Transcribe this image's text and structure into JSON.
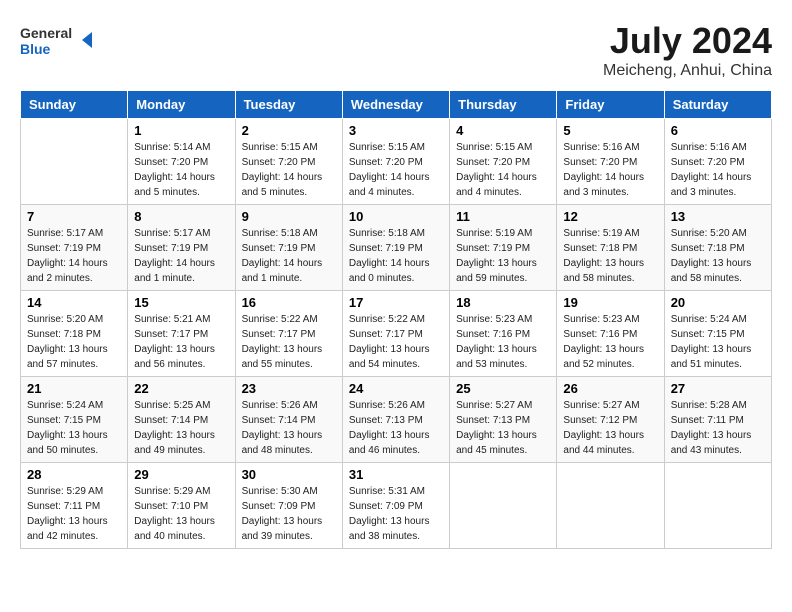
{
  "header": {
    "logo_text_general": "General",
    "logo_text_blue": "Blue",
    "month_year": "July 2024",
    "location": "Meicheng, Anhui, China"
  },
  "weekdays": [
    "Sunday",
    "Monday",
    "Tuesday",
    "Wednesday",
    "Thursday",
    "Friday",
    "Saturday"
  ],
  "weeks": [
    [
      {
        "day": "",
        "sunrise": "",
        "sunset": "",
        "daylight": ""
      },
      {
        "day": "1",
        "sunrise": "Sunrise: 5:14 AM",
        "sunset": "Sunset: 7:20 PM",
        "daylight": "Daylight: 14 hours and 5 minutes."
      },
      {
        "day": "2",
        "sunrise": "Sunrise: 5:15 AM",
        "sunset": "Sunset: 7:20 PM",
        "daylight": "Daylight: 14 hours and 5 minutes."
      },
      {
        "day": "3",
        "sunrise": "Sunrise: 5:15 AM",
        "sunset": "Sunset: 7:20 PM",
        "daylight": "Daylight: 14 hours and 4 minutes."
      },
      {
        "day": "4",
        "sunrise": "Sunrise: 5:15 AM",
        "sunset": "Sunset: 7:20 PM",
        "daylight": "Daylight: 14 hours and 4 minutes."
      },
      {
        "day": "5",
        "sunrise": "Sunrise: 5:16 AM",
        "sunset": "Sunset: 7:20 PM",
        "daylight": "Daylight: 14 hours and 3 minutes."
      },
      {
        "day": "6",
        "sunrise": "Sunrise: 5:16 AM",
        "sunset": "Sunset: 7:20 PM",
        "daylight": "Daylight: 14 hours and 3 minutes."
      }
    ],
    [
      {
        "day": "7",
        "sunrise": "Sunrise: 5:17 AM",
        "sunset": "Sunset: 7:19 PM",
        "daylight": "Daylight: 14 hours and 2 minutes."
      },
      {
        "day": "8",
        "sunrise": "Sunrise: 5:17 AM",
        "sunset": "Sunset: 7:19 PM",
        "daylight": "Daylight: 14 hours and 1 minute."
      },
      {
        "day": "9",
        "sunrise": "Sunrise: 5:18 AM",
        "sunset": "Sunset: 7:19 PM",
        "daylight": "Daylight: 14 hours and 1 minute."
      },
      {
        "day": "10",
        "sunrise": "Sunrise: 5:18 AM",
        "sunset": "Sunset: 7:19 PM",
        "daylight": "Daylight: 14 hours and 0 minutes."
      },
      {
        "day": "11",
        "sunrise": "Sunrise: 5:19 AM",
        "sunset": "Sunset: 7:19 PM",
        "daylight": "Daylight: 13 hours and 59 minutes."
      },
      {
        "day": "12",
        "sunrise": "Sunrise: 5:19 AM",
        "sunset": "Sunset: 7:18 PM",
        "daylight": "Daylight: 13 hours and 58 minutes."
      },
      {
        "day": "13",
        "sunrise": "Sunrise: 5:20 AM",
        "sunset": "Sunset: 7:18 PM",
        "daylight": "Daylight: 13 hours and 58 minutes."
      }
    ],
    [
      {
        "day": "14",
        "sunrise": "Sunrise: 5:20 AM",
        "sunset": "Sunset: 7:18 PM",
        "daylight": "Daylight: 13 hours and 57 minutes."
      },
      {
        "day": "15",
        "sunrise": "Sunrise: 5:21 AM",
        "sunset": "Sunset: 7:17 PM",
        "daylight": "Daylight: 13 hours and 56 minutes."
      },
      {
        "day": "16",
        "sunrise": "Sunrise: 5:22 AM",
        "sunset": "Sunset: 7:17 PM",
        "daylight": "Daylight: 13 hours and 55 minutes."
      },
      {
        "day": "17",
        "sunrise": "Sunrise: 5:22 AM",
        "sunset": "Sunset: 7:17 PM",
        "daylight": "Daylight: 13 hours and 54 minutes."
      },
      {
        "day": "18",
        "sunrise": "Sunrise: 5:23 AM",
        "sunset": "Sunset: 7:16 PM",
        "daylight": "Daylight: 13 hours and 53 minutes."
      },
      {
        "day": "19",
        "sunrise": "Sunrise: 5:23 AM",
        "sunset": "Sunset: 7:16 PM",
        "daylight": "Daylight: 13 hours and 52 minutes."
      },
      {
        "day": "20",
        "sunrise": "Sunrise: 5:24 AM",
        "sunset": "Sunset: 7:15 PM",
        "daylight": "Daylight: 13 hours and 51 minutes."
      }
    ],
    [
      {
        "day": "21",
        "sunrise": "Sunrise: 5:24 AM",
        "sunset": "Sunset: 7:15 PM",
        "daylight": "Daylight: 13 hours and 50 minutes."
      },
      {
        "day": "22",
        "sunrise": "Sunrise: 5:25 AM",
        "sunset": "Sunset: 7:14 PM",
        "daylight": "Daylight: 13 hours and 49 minutes."
      },
      {
        "day": "23",
        "sunrise": "Sunrise: 5:26 AM",
        "sunset": "Sunset: 7:14 PM",
        "daylight": "Daylight: 13 hours and 48 minutes."
      },
      {
        "day": "24",
        "sunrise": "Sunrise: 5:26 AM",
        "sunset": "Sunset: 7:13 PM",
        "daylight": "Daylight: 13 hours and 46 minutes."
      },
      {
        "day": "25",
        "sunrise": "Sunrise: 5:27 AM",
        "sunset": "Sunset: 7:13 PM",
        "daylight": "Daylight: 13 hours and 45 minutes."
      },
      {
        "day": "26",
        "sunrise": "Sunrise: 5:27 AM",
        "sunset": "Sunset: 7:12 PM",
        "daylight": "Daylight: 13 hours and 44 minutes."
      },
      {
        "day": "27",
        "sunrise": "Sunrise: 5:28 AM",
        "sunset": "Sunset: 7:11 PM",
        "daylight": "Daylight: 13 hours and 43 minutes."
      }
    ],
    [
      {
        "day": "28",
        "sunrise": "Sunrise: 5:29 AM",
        "sunset": "Sunset: 7:11 PM",
        "daylight": "Daylight: 13 hours and 42 minutes."
      },
      {
        "day": "29",
        "sunrise": "Sunrise: 5:29 AM",
        "sunset": "Sunset: 7:10 PM",
        "daylight": "Daylight: 13 hours and 40 minutes."
      },
      {
        "day": "30",
        "sunrise": "Sunrise: 5:30 AM",
        "sunset": "Sunset: 7:09 PM",
        "daylight": "Daylight: 13 hours and 39 minutes."
      },
      {
        "day": "31",
        "sunrise": "Sunrise: 5:31 AM",
        "sunset": "Sunset: 7:09 PM",
        "daylight": "Daylight: 13 hours and 38 minutes."
      },
      {
        "day": "",
        "sunrise": "",
        "sunset": "",
        "daylight": ""
      },
      {
        "day": "",
        "sunrise": "",
        "sunset": "",
        "daylight": ""
      },
      {
        "day": "",
        "sunrise": "",
        "sunset": "",
        "daylight": ""
      }
    ]
  ]
}
